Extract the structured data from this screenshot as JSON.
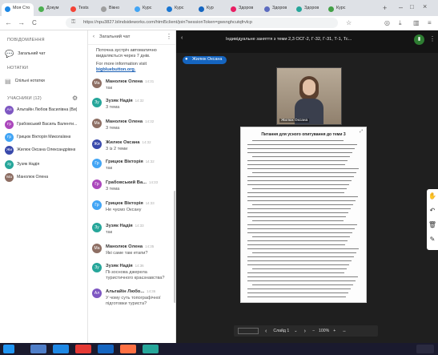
{
  "browser": {
    "tabs": [
      {
        "label": "Моя Сто",
        "color": "#1e88e5"
      },
      {
        "label": "Докум",
        "color": "#4caf50"
      },
      {
        "label": "Tests",
        "color": "#f44336"
      },
      {
        "label": "Вікно",
        "color": "#9e9e9e"
      },
      {
        "label": "Курс",
        "color": "#42a5f5"
      },
      {
        "label": "Курс",
        "color": "#1976d2"
      },
      {
        "label": "Кур",
        "color": "#1565c0"
      },
      {
        "label": "Здоров",
        "color": "#e91e63"
      },
      {
        "label": "Здоров",
        "color": "#5c6bc0"
      },
      {
        "label": "Здоров",
        "color": "#26a69a"
      },
      {
        "label": "Курс",
        "color": "#43a047"
      }
    ],
    "url": "https://npu3827.blindsideworks.com/html5client/join?sessionToken=gwsnghcutqfrvlcp",
    "back": "←",
    "forward": "→",
    "reload": "C"
  },
  "sidebar": {
    "messages_header": "Повідомлення",
    "public_chat": "Загальний чат",
    "notes_header": "Нотатки",
    "shared_notes": "Спільні нотатки",
    "users_header": "Учасники (12)",
    "users": [
      {
        "initials": "Ал",
        "name": "Альтайін Любов Василівна (Ви)",
        "color": "#7e57c2"
      },
      {
        "initials": "Гр",
        "name": "Грабовський Василь Валенти...",
        "color": "#ab47bc"
      },
      {
        "initials": "Гр",
        "name": "Грицюк Вікторія Миколаївна",
        "color": "#42a5f5"
      },
      {
        "initials": "Жи",
        "name": "Жилюк Оксана Олександрівна",
        "color": "#3949ab"
      },
      {
        "initials": "Зу",
        "name": "Зузяк Надія",
        "color": "#26a69a"
      },
      {
        "initials": "Ма",
        "name": "Манолюк Олена",
        "color": "#8d6e63"
      }
    ]
  },
  "chat": {
    "header": "Загальний чат",
    "notice_1": "Поточна зустріч автоматично видаляється через 7 днів.",
    "notice_2": "For more information visit",
    "notice_link": "bigbluebutton.org.",
    "messages": [
      {
        "initials": "Ма",
        "name": "Манолюк Олена",
        "time": "14:31",
        "text": "так",
        "color": "#8d6e63"
      },
      {
        "initials": "Зу",
        "name": "Зузяк Надія",
        "time": "14:32",
        "text": "3 тема",
        "color": "#26a69a"
      },
      {
        "initials": "Ма",
        "name": "Манолюк Олена",
        "time": "14:32",
        "text": "3 тема",
        "color": "#8d6e63"
      },
      {
        "initials": "Жи",
        "name": "Жилюк Оксана",
        "time": "14:32",
        "text": "3 із 2 теми",
        "color": "#3949ab"
      },
      {
        "initials": "Гр",
        "name": "Грицюк Вікторія",
        "time": "14:32",
        "text": "так",
        "color": "#42a5f5"
      },
      {
        "initials": "Гр",
        "name": "Грабовський Ва...",
        "time": "14:33",
        "text": "3 тема",
        "color": "#ab47bc"
      },
      {
        "initials": "Гр",
        "name": "Грицюк Вікторія",
        "time": "14:33",
        "text": "Не чуємо Оксану",
        "color": "#42a5f5"
      },
      {
        "initials": "Зу",
        "name": "Зузяк Надія",
        "time": "14:33",
        "text": "так",
        "color": "#26a69a"
      },
      {
        "initials": "Ма",
        "name": "Манолюк Олена",
        "time": "14:35",
        "text": "Які саме там етапи?",
        "color": "#8d6e63"
      },
      {
        "initials": "Зу",
        "name": "Зузяк Надія",
        "time": "14:36",
        "text": "Пі-зоснова джерела",
        "text2": "туристичного краєзнавства?",
        "color": "#26a69a"
      },
      {
        "initials": "Ал",
        "name": "Альтайін Любо...",
        "time": "14:36",
        "text": "У чому суть топографічної",
        "text2": "підготовки туриста?",
        "color": "#7e57c2"
      }
    ]
  },
  "stage": {
    "title": "Індивідуальне заняття з теми 2,3 ОСГ-2, Г-32, Г-31, Т-1, Тс...",
    "presenter_badge": "Жилюк Оксана",
    "webcam_label": "Жилюк Оксана",
    "doc_title": "Питання для усного опитування до теми 3",
    "slide_label": "Слайд 1",
    "zoom": "100%",
    "minus": "−",
    "plus": "+",
    "dock_icons": [
      "hand-icon",
      "undo-icon",
      "trash-icon",
      "pen-icon",
      "chart-icon"
    ]
  }
}
